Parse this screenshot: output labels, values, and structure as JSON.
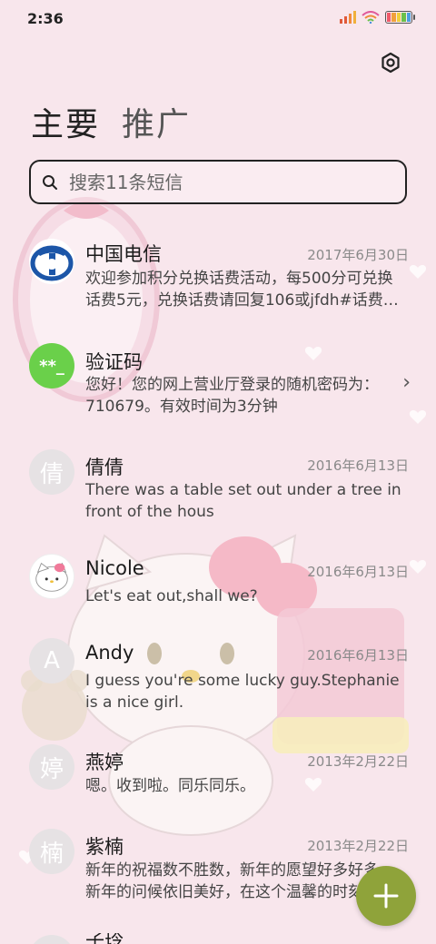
{
  "status_bar": {
    "time": "2:36"
  },
  "tabs": [
    {
      "label": "主要"
    },
    {
      "label": "推广"
    }
  ],
  "search": {
    "placeholder": "搜索11条短信"
  },
  "messages": [
    {
      "name": "中国电信",
      "date": "2017年6月30日",
      "preview": "欢迎参加积分兑换话费活动，每500分可兑换话费5元，兑换话费请回复106或jfdh#话费…",
      "avatar": "china-telecom-logo"
    },
    {
      "name": "验证码",
      "avatar_text": "**_",
      "preview": "您好！您的网上营业厅登录的随机密码为：710679。有效时间为3分钟"
    },
    {
      "name": "倩倩",
      "date": "2016年6月13日",
      "avatar_text": "倩",
      "preview": "There was a table set out under a tree in front of the hous"
    },
    {
      "name": "Nicole",
      "date": "2016年6月13日",
      "preview": "Let's eat out,shall we?",
      "avatar": "hello-kitty-avatar"
    },
    {
      "name": "Andy",
      "date": "2016年6月13日",
      "avatar_text": "A",
      "preview": "I guess you're some lucky guy.Stephanie is a nice girl."
    },
    {
      "name": "燕婷",
      "date": "2013年2月22日",
      "avatar_text": "婷",
      "preview": "嗯。收到啦。同乐同乐。"
    },
    {
      "name": "紫楠",
      "date": "2013年2月22日",
      "avatar_text": "楠",
      "preview": "新年的祝福数不胜数，新年的愿望好多好多，新年的问候依旧美好，在这个温馨的时刻"
    },
    {
      "name": "子玲",
      "avatar_text": "玲"
    }
  ],
  "colors": {
    "accent": "#8fa33a",
    "verification_avatar": "#6ad04a",
    "background": "#f8e6ec"
  }
}
